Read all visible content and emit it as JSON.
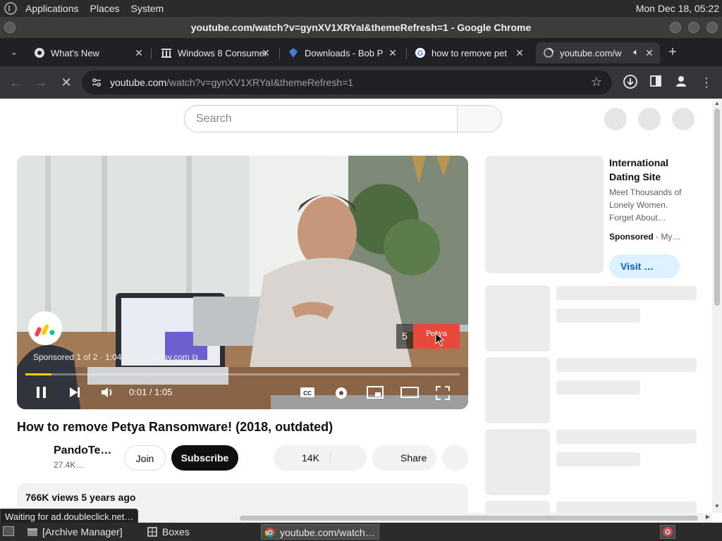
{
  "top_panel": {
    "menus": [
      "Applications",
      "Places",
      "System"
    ],
    "clock": "Mon Dec 18, 05:22"
  },
  "window": {
    "title": "youtube.com/watch?v=gynXV1XRYaI&themeRefresh=1 - Google Chrome"
  },
  "tabs": [
    {
      "label": "What's New",
      "icon": "chrome-icon"
    },
    {
      "label": "Windows 8 Consumer",
      "icon": "building-icon"
    },
    {
      "label": "Downloads - Bob P",
      "icon": "puzzle-icon"
    },
    {
      "label": "how to remove pet",
      "icon": "google-icon"
    },
    {
      "label": "youtube.com/w",
      "icon": "loading-icon",
      "active": true
    }
  ],
  "toolbar": {
    "url_domain": "youtube.com",
    "url_path": "/watch?v=gynXV1XRYaI&themeRefresh=1"
  },
  "youtube": {
    "search_placeholder": "Search",
    "player": {
      "sponsored_text": "Sponsored 1 of 2 · 1:04",
      "ad_domain": "monday.com",
      "time": "0:01 / 1:05",
      "progress_fraction": 0.06,
      "skip_countdown": "5",
      "skip_thumb_label": "Petya"
    },
    "video_title": "How to remove Petya Ransomware! (2018, outdated)",
    "channel_name": "PandoTe…",
    "channel_subs": "27.4K…",
    "join_label": "Join",
    "subscribe_label": "Subscribe",
    "likes": "14K",
    "share_label": "Share",
    "views_line": "766K views  5 years ago",
    "sidebar_ad": {
      "title": "International Dating Site",
      "description": "Meet Thousands of Lonely Women. Forget About…",
      "sponsored": "Sponsored",
      "advertiser": "My…",
      "visit_label": "Visit …"
    }
  },
  "status_text": "Waiting for ad.doubleclick.net…",
  "taskbar": {
    "tasks": [
      {
        "label": "[Archive Manager]",
        "icon": "archive-icon"
      },
      {
        "label": "Boxes",
        "icon": "boxes-icon"
      },
      {
        "label": "youtube.com/watch…",
        "icon": "chrome-icon",
        "active": true
      }
    ]
  },
  "colors": {
    "yt_subscribe_bg": "#0f0f0f",
    "progress_fill": "#ffcc00",
    "visit_button_bg": "#def1ff",
    "visit_button_text": "#065fd4"
  }
}
